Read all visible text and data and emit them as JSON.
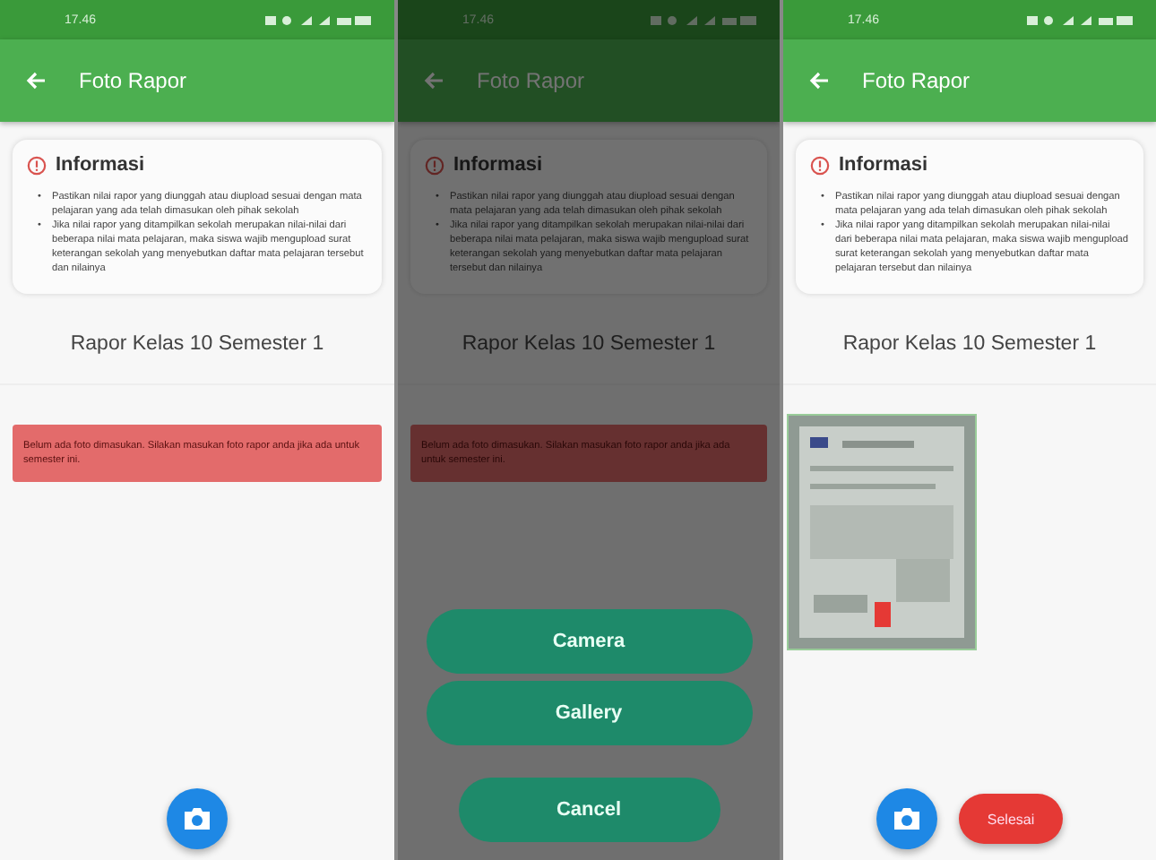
{
  "screens": [
    {
      "status_time": "17.46",
      "title": "Foto Rapor",
      "info": {
        "title": "Informasi",
        "bullets": [
          {
            "marker": "•",
            "text": "Pastikan nilai rapor yang diunggah atau diupload sesuai dengan mata pelajaran yang ada telah dimasukan oleh pihak sekolah"
          },
          {
            "marker": "•",
            "text": "Jika nilai rapor yang ditampilkan sekolah merupakan nilai-nilai dari beberapa nilai mata pelajaran, maka siswa wajib mengupload surat keterangan sekolah yang menyebutkan daftar mata pelajaran tersebut dan nilainya"
          }
        ]
      },
      "section": "Rapor Kelas 10 Semester 1",
      "alert": "Belum ada foto dimasukan. Silakan masukan foto rapor anda jika ada untuk semester ini.",
      "dimmed": false
    },
    {
      "status_time": "17.46",
      "title": "Foto Rapor",
      "info": {
        "title": "Informasi",
        "bullets": [
          {
            "marker": "•",
            "text": "Pastikan nilai rapor yang diunggah atau diupload sesuai dengan mata pelajaran yang ada telah dimasukan oleh pihak sekolah"
          },
          {
            "marker": "•",
            "text": "Jika nilai rapor yang ditampilkan sekolah merupakan nilai-nilai dari beberapa nilai mata pelajaran, maka siswa wajib mengupload surat keterangan sekolah yang menyebutkan daftar mata pelajaran tersebut dan nilainya"
          }
        ]
      },
      "section": "Rapor Kelas 10 Semester 1",
      "alert": "Belum ada foto dimasukan. Silakan masukan foto rapor anda jika ada untuk semester ini.",
      "dimmed": true,
      "sheet": {
        "options": [
          "Camera",
          "Gallery"
        ],
        "cancel": "Cancel"
      }
    },
    {
      "status_time": "17.46",
      "title": "Foto Rapor",
      "info": {
        "title": "Informasi",
        "bullets": [
          {
            "marker": "•",
            "text": "Pastikan nilai rapor yang diunggah atau diupload sesuai dengan mata pelajaran yang ada telah dimasukan oleh pihak sekolah"
          },
          {
            "marker": "•",
            "text": "Jika nilai rapor yang ditampilkan sekolah merupakan nilai-nilai dari beberapa nilai mata pelajaran, maka siswa wajib mengupload surat keterangan sekolah yang menyebutkan daftar mata pelajaran tersebut dan nilainya"
          }
        ]
      },
      "section": "Rapor Kelas 10 Semester 1",
      "dimmed": false,
      "done": "Selesai"
    }
  ]
}
